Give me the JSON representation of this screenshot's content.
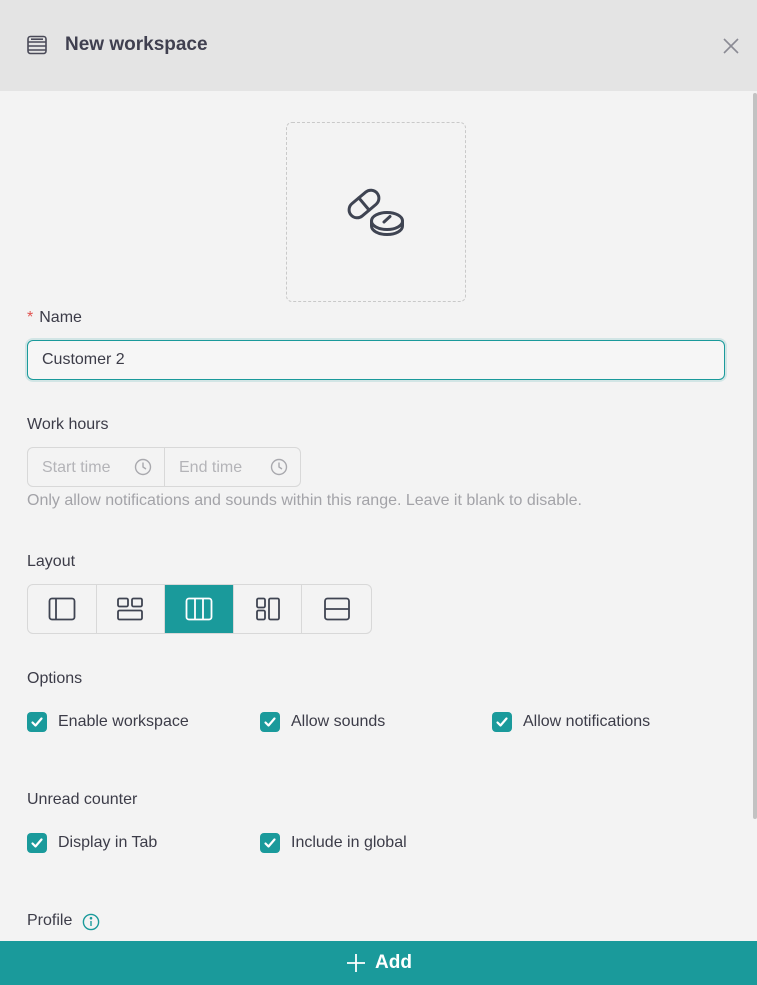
{
  "header": {
    "title": "New workspace",
    "icon": "workspace-icon",
    "close_icon": "close-icon"
  },
  "icon_picker": {
    "icon": "pills-icon"
  },
  "name": {
    "label": "Name",
    "required_mark": "*",
    "value": "Customer 2"
  },
  "work_hours": {
    "label": "Work hours",
    "start_placeholder": "Start time",
    "end_placeholder": "End time",
    "hint": "Only allow notifications and sounds within this range. Leave it blank to disable."
  },
  "layout": {
    "label": "Layout",
    "options": [
      "sidebar-left",
      "grid-top",
      "columns",
      "grid-left",
      "rows"
    ],
    "selected": "columns"
  },
  "options": {
    "label": "Options",
    "items": [
      {
        "label": "Enable workspace",
        "checked": true
      },
      {
        "label": "Allow sounds",
        "checked": true
      },
      {
        "label": "Allow notifications",
        "checked": true
      }
    ]
  },
  "unread_counter": {
    "label": "Unread counter",
    "items": [
      {
        "label": "Display in Tab",
        "checked": true
      },
      {
        "label": "Include in global",
        "checked": true
      }
    ]
  },
  "profile": {
    "label": "Profile",
    "icon": "info-icon"
  },
  "footer": {
    "add_label": "Add"
  },
  "colors": {
    "accent": "#1a9a9b",
    "required": "#e0524f",
    "header_bg": "#e4e4e4",
    "body_bg": "#f3f3f3"
  }
}
